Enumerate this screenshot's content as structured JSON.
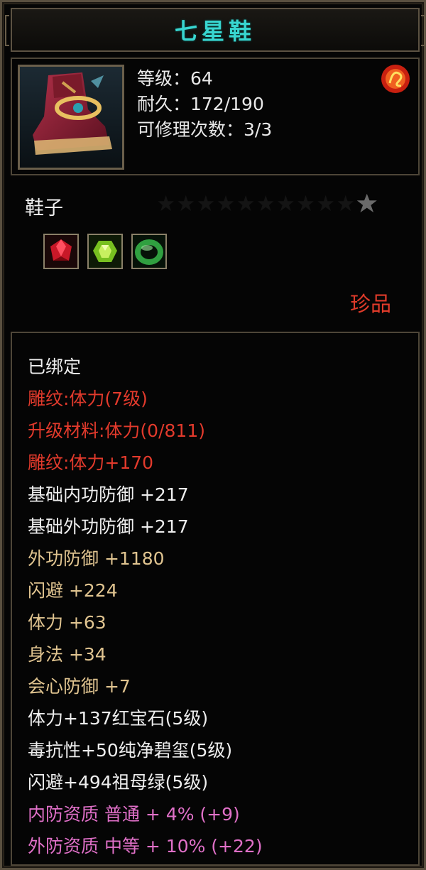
{
  "item": {
    "name": "七星鞋",
    "stats": {
      "level": "等级：64",
      "durability": "耐久：172/190",
      "repairs": "可修理次数：3/3"
    },
    "type": "鞋子",
    "rarity": "珍品",
    "star_icon": "star-icon",
    "gems": [
      {
        "icon": "ruby-gem-icon",
        "color": "#d02030"
      },
      {
        "icon": "peridot-gem-icon",
        "color": "#8ad030"
      },
      {
        "icon": "jade-ring-icon",
        "color": "#30b040"
      }
    ]
  },
  "attributes": [
    {
      "text": "已绑定",
      "color": "white"
    },
    {
      "text": "雕纹:体力(7级)",
      "color": "red"
    },
    {
      "text": "升级材料:体力(0/811)",
      "color": "red"
    },
    {
      "text": "雕纹:体力+170",
      "color": "red"
    },
    {
      "text": "基础内功防御 +217",
      "color": "white"
    },
    {
      "text": "基础外功防御 +217",
      "color": "white"
    },
    {
      "text": "外功防御 +1180",
      "color": "tan"
    },
    {
      "text": "闪避 +224",
      "color": "tan"
    },
    {
      "text": "体力 +63",
      "color": "tan"
    },
    {
      "text": "身法 +34",
      "color": "tan"
    },
    {
      "text": "会心防御 +7",
      "color": "tan"
    },
    {
      "text": "体力+137红宝石(5级)",
      "color": "white"
    },
    {
      "text": "毒抗性+50纯净碧玺(5级)",
      "color": "white"
    },
    {
      "text": "闪避+494祖母绿(5级)",
      "color": "white"
    },
    {
      "text": "内防资质 普通 + 4% (+9)",
      "color": "pink"
    },
    {
      "text": "外防资质 中等 + 10% (+22)",
      "color": "pink"
    }
  ],
  "colors": {
    "title": "#38d6d0",
    "white": "#eeeeee",
    "red": "#e23a2c",
    "tan": "#e0c490",
    "pink": "#e070c8",
    "border": "#5a5040"
  }
}
